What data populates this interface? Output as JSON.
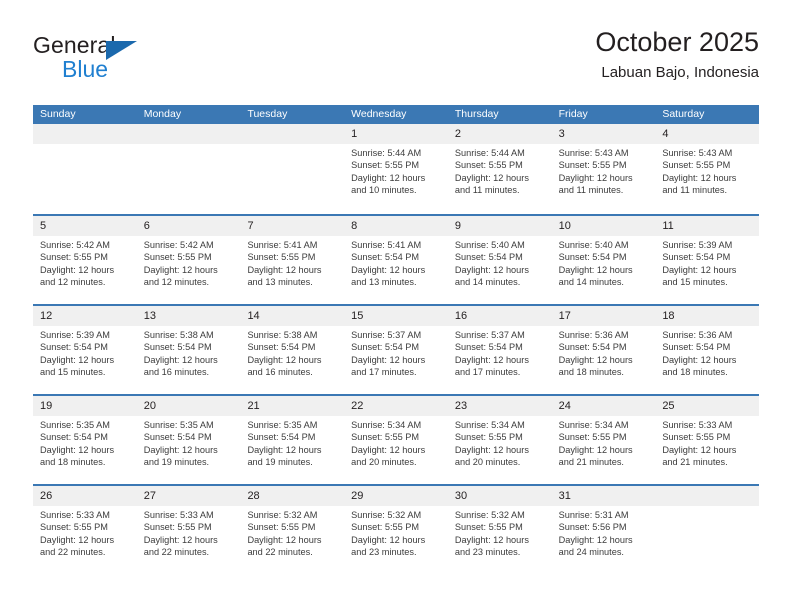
{
  "brand": {
    "name_part1": "General",
    "name_part2": "Blue",
    "logo_icon": "triangle-flag-icon"
  },
  "header": {
    "title": "October 2025",
    "subtitle": "Labuan Bajo, Indonesia"
  },
  "colors": {
    "header_blue": "#3b78b4",
    "brand_blue": "#1f7fd0",
    "logo_blue": "#1b69ad",
    "day_band_gray": "#f0f0f0",
    "text": "#231f20"
  },
  "weekdays": [
    "Sunday",
    "Monday",
    "Tuesday",
    "Wednesday",
    "Thursday",
    "Friday",
    "Saturday"
  ],
  "weeks": [
    [
      {
        "day": "",
        "empty": true,
        "sunrise": "",
        "sunset": "",
        "daylight1": "",
        "daylight2": ""
      },
      {
        "day": "",
        "empty": true,
        "sunrise": "",
        "sunset": "",
        "daylight1": "",
        "daylight2": ""
      },
      {
        "day": "",
        "empty": true,
        "sunrise": "",
        "sunset": "",
        "daylight1": "",
        "daylight2": ""
      },
      {
        "day": "1",
        "empty": false,
        "sunrise": "Sunrise: 5:44 AM",
        "sunset": "Sunset: 5:55 PM",
        "daylight1": "Daylight: 12 hours",
        "daylight2": "and 10 minutes."
      },
      {
        "day": "2",
        "empty": false,
        "sunrise": "Sunrise: 5:44 AM",
        "sunset": "Sunset: 5:55 PM",
        "daylight1": "Daylight: 12 hours",
        "daylight2": "and 11 minutes."
      },
      {
        "day": "3",
        "empty": false,
        "sunrise": "Sunrise: 5:43 AM",
        "sunset": "Sunset: 5:55 PM",
        "daylight1": "Daylight: 12 hours",
        "daylight2": "and 11 minutes."
      },
      {
        "day": "4",
        "empty": false,
        "sunrise": "Sunrise: 5:43 AM",
        "sunset": "Sunset: 5:55 PM",
        "daylight1": "Daylight: 12 hours",
        "daylight2": "and 11 minutes."
      }
    ],
    [
      {
        "day": "5",
        "empty": false,
        "sunrise": "Sunrise: 5:42 AM",
        "sunset": "Sunset: 5:55 PM",
        "daylight1": "Daylight: 12 hours",
        "daylight2": "and 12 minutes."
      },
      {
        "day": "6",
        "empty": false,
        "sunrise": "Sunrise: 5:42 AM",
        "sunset": "Sunset: 5:55 PM",
        "daylight1": "Daylight: 12 hours",
        "daylight2": "and 12 minutes."
      },
      {
        "day": "7",
        "empty": false,
        "sunrise": "Sunrise: 5:41 AM",
        "sunset": "Sunset: 5:55 PM",
        "daylight1": "Daylight: 12 hours",
        "daylight2": "and 13 minutes."
      },
      {
        "day": "8",
        "empty": false,
        "sunrise": "Sunrise: 5:41 AM",
        "sunset": "Sunset: 5:54 PM",
        "daylight1": "Daylight: 12 hours",
        "daylight2": "and 13 minutes."
      },
      {
        "day": "9",
        "empty": false,
        "sunrise": "Sunrise: 5:40 AM",
        "sunset": "Sunset: 5:54 PM",
        "daylight1": "Daylight: 12 hours",
        "daylight2": "and 14 minutes."
      },
      {
        "day": "10",
        "empty": false,
        "sunrise": "Sunrise: 5:40 AM",
        "sunset": "Sunset: 5:54 PM",
        "daylight1": "Daylight: 12 hours",
        "daylight2": "and 14 minutes."
      },
      {
        "day": "11",
        "empty": false,
        "sunrise": "Sunrise: 5:39 AM",
        "sunset": "Sunset: 5:54 PM",
        "daylight1": "Daylight: 12 hours",
        "daylight2": "and 15 minutes."
      }
    ],
    [
      {
        "day": "12",
        "empty": false,
        "sunrise": "Sunrise: 5:39 AM",
        "sunset": "Sunset: 5:54 PM",
        "daylight1": "Daylight: 12 hours",
        "daylight2": "and 15 minutes."
      },
      {
        "day": "13",
        "empty": false,
        "sunrise": "Sunrise: 5:38 AM",
        "sunset": "Sunset: 5:54 PM",
        "daylight1": "Daylight: 12 hours",
        "daylight2": "and 16 minutes."
      },
      {
        "day": "14",
        "empty": false,
        "sunrise": "Sunrise: 5:38 AM",
        "sunset": "Sunset: 5:54 PM",
        "daylight1": "Daylight: 12 hours",
        "daylight2": "and 16 minutes."
      },
      {
        "day": "15",
        "empty": false,
        "sunrise": "Sunrise: 5:37 AM",
        "sunset": "Sunset: 5:54 PM",
        "daylight1": "Daylight: 12 hours",
        "daylight2": "and 17 minutes."
      },
      {
        "day": "16",
        "empty": false,
        "sunrise": "Sunrise: 5:37 AM",
        "sunset": "Sunset: 5:54 PM",
        "daylight1": "Daylight: 12 hours",
        "daylight2": "and 17 minutes."
      },
      {
        "day": "17",
        "empty": false,
        "sunrise": "Sunrise: 5:36 AM",
        "sunset": "Sunset: 5:54 PM",
        "daylight1": "Daylight: 12 hours",
        "daylight2": "and 18 minutes."
      },
      {
        "day": "18",
        "empty": false,
        "sunrise": "Sunrise: 5:36 AM",
        "sunset": "Sunset: 5:54 PM",
        "daylight1": "Daylight: 12 hours",
        "daylight2": "and 18 minutes."
      }
    ],
    [
      {
        "day": "19",
        "empty": false,
        "sunrise": "Sunrise: 5:35 AM",
        "sunset": "Sunset: 5:54 PM",
        "daylight1": "Daylight: 12 hours",
        "daylight2": "and 18 minutes."
      },
      {
        "day": "20",
        "empty": false,
        "sunrise": "Sunrise: 5:35 AM",
        "sunset": "Sunset: 5:54 PM",
        "daylight1": "Daylight: 12 hours",
        "daylight2": "and 19 minutes."
      },
      {
        "day": "21",
        "empty": false,
        "sunrise": "Sunrise: 5:35 AM",
        "sunset": "Sunset: 5:54 PM",
        "daylight1": "Daylight: 12 hours",
        "daylight2": "and 19 minutes."
      },
      {
        "day": "22",
        "empty": false,
        "sunrise": "Sunrise: 5:34 AM",
        "sunset": "Sunset: 5:55 PM",
        "daylight1": "Daylight: 12 hours",
        "daylight2": "and 20 minutes."
      },
      {
        "day": "23",
        "empty": false,
        "sunrise": "Sunrise: 5:34 AM",
        "sunset": "Sunset: 5:55 PM",
        "daylight1": "Daylight: 12 hours",
        "daylight2": "and 20 minutes."
      },
      {
        "day": "24",
        "empty": false,
        "sunrise": "Sunrise: 5:34 AM",
        "sunset": "Sunset: 5:55 PM",
        "daylight1": "Daylight: 12 hours",
        "daylight2": "and 21 minutes."
      },
      {
        "day": "25",
        "empty": false,
        "sunrise": "Sunrise: 5:33 AM",
        "sunset": "Sunset: 5:55 PM",
        "daylight1": "Daylight: 12 hours",
        "daylight2": "and 21 minutes."
      }
    ],
    [
      {
        "day": "26",
        "empty": false,
        "sunrise": "Sunrise: 5:33 AM",
        "sunset": "Sunset: 5:55 PM",
        "daylight1": "Daylight: 12 hours",
        "daylight2": "and 22 minutes."
      },
      {
        "day": "27",
        "empty": false,
        "sunrise": "Sunrise: 5:33 AM",
        "sunset": "Sunset: 5:55 PM",
        "daylight1": "Daylight: 12 hours",
        "daylight2": "and 22 minutes."
      },
      {
        "day": "28",
        "empty": false,
        "sunrise": "Sunrise: 5:32 AM",
        "sunset": "Sunset: 5:55 PM",
        "daylight1": "Daylight: 12 hours",
        "daylight2": "and 22 minutes."
      },
      {
        "day": "29",
        "empty": false,
        "sunrise": "Sunrise: 5:32 AM",
        "sunset": "Sunset: 5:55 PM",
        "daylight1": "Daylight: 12 hours",
        "daylight2": "and 23 minutes."
      },
      {
        "day": "30",
        "empty": false,
        "sunrise": "Sunrise: 5:32 AM",
        "sunset": "Sunset: 5:55 PM",
        "daylight1": "Daylight: 12 hours",
        "daylight2": "and 23 minutes."
      },
      {
        "day": "31",
        "empty": false,
        "sunrise": "Sunrise: 5:31 AM",
        "sunset": "Sunset: 5:56 PM",
        "daylight1": "Daylight: 12 hours",
        "daylight2": "and 24 minutes."
      },
      {
        "day": "",
        "empty": true,
        "sunrise": "",
        "sunset": "",
        "daylight1": "",
        "daylight2": ""
      }
    ]
  ]
}
